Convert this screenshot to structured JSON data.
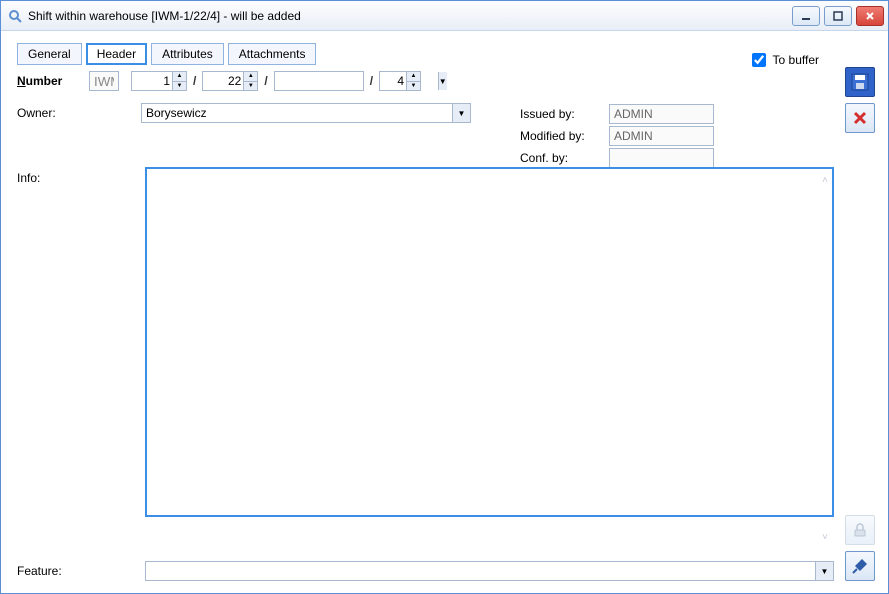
{
  "window": {
    "title": "Shift within warehouse [IWM-1/22/4]  - will be added"
  },
  "tabs": {
    "general": "General",
    "header": "Header",
    "attributes": "Attributes",
    "attachments": "Attachments",
    "active": "header"
  },
  "buffer": {
    "label": "To buffer",
    "checked": true
  },
  "number": {
    "label": "Number",
    "code": "IWM",
    "seg1": "1",
    "seg2": "22",
    "seg3": "",
    "seg4": "4"
  },
  "owner": {
    "label": "Owner:",
    "value": "Borysewicz"
  },
  "meta": {
    "issued_by_label": "Issued by:",
    "issued_by": "ADMIN",
    "modified_by_label": "Modified by:",
    "modified_by": "ADMIN",
    "conf_by_label": "Conf. by:",
    "conf_by": ""
  },
  "info": {
    "label": "Info:",
    "value": ""
  },
  "feature": {
    "label": "Feature:",
    "value": ""
  }
}
